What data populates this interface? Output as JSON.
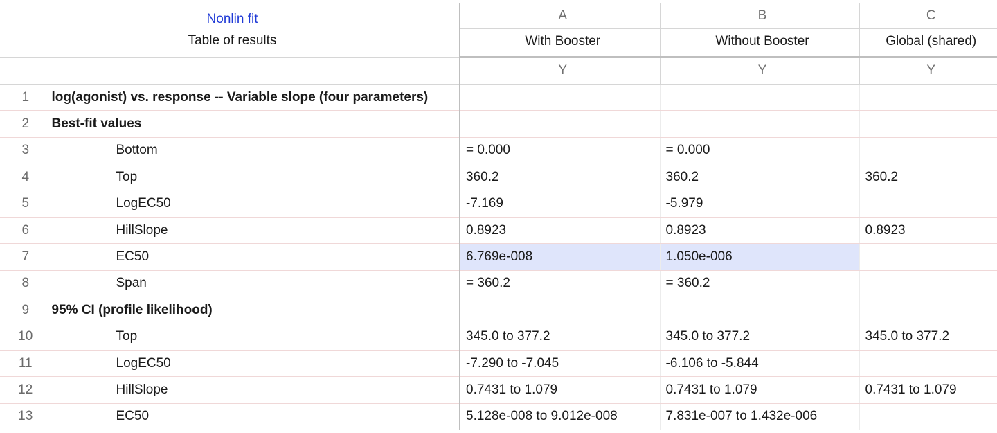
{
  "sheet": {
    "title": "Nonlin fit",
    "subtitle": "Table of results"
  },
  "columns": [
    {
      "letter": "A",
      "name": "With Booster",
      "sub": "Y"
    },
    {
      "letter": "B",
      "name": "Without Booster",
      "sub": "Y"
    },
    {
      "letter": "C",
      "name": "Global (shared)",
      "sub": "Y"
    }
  ],
  "rows": [
    {
      "num": "1",
      "label": "log(agonist) vs. response -- Variable slope (four parameters)",
      "style": "bold",
      "values": [
        "",
        "",
        ""
      ]
    },
    {
      "num": "2",
      "label": "Best-fit values",
      "style": "bold",
      "values": [
        "",
        "",
        ""
      ]
    },
    {
      "num": "3",
      "label": "Bottom",
      "style": "indent",
      "values": [
        "= 0.000",
        "= 0.000",
        ""
      ]
    },
    {
      "num": "4",
      "label": "Top",
      "style": "indent",
      "values": [
        "360.2",
        "360.2",
        "360.2"
      ]
    },
    {
      "num": "5",
      "label": "LogEC50",
      "style": "indent",
      "values": [
        "-7.169",
        "-5.979",
        ""
      ]
    },
    {
      "num": "6",
      "label": "HillSlope",
      "style": "indent",
      "values": [
        "0.8923",
        "0.8923",
        "0.8923"
      ]
    },
    {
      "num": "7",
      "label": "EC50",
      "style": "indent",
      "values": [
        "6.769e-008",
        "1.050e-006",
        ""
      ]
    },
    {
      "num": "8",
      "label": "Span",
      "style": "indent",
      "values": [
        "= 360.2",
        "= 360.2",
        ""
      ]
    },
    {
      "num": "9",
      "label": "95% CI (profile likelihood)",
      "style": "bold",
      "values": [
        "",
        "",
        ""
      ]
    },
    {
      "num": "10",
      "label": "Top",
      "style": "indent",
      "values": [
        "345.0 to 377.2",
        "345.0 to 377.2",
        "345.0 to 377.2"
      ]
    },
    {
      "num": "11",
      "label": "LogEC50",
      "style": "indent",
      "values": [
        "-7.290 to -7.045",
        "-6.106 to -5.844",
        ""
      ]
    },
    {
      "num": "12",
      "label": "HillSlope",
      "style": "indent",
      "values": [
        "0.7431 to 1.079",
        "0.7431 to 1.079",
        "0.7431 to 1.079"
      ]
    },
    {
      "num": "13",
      "label": "EC50",
      "style": "indent",
      "values": [
        "5.128e-008 to 9.012e-008",
        "7.831e-007 to 1.432e-006",
        ""
      ]
    }
  ],
  "highlight": {
    "row": "7",
    "columns": [
      "A",
      "B"
    ],
    "color": "#dfe5fb"
  }
}
